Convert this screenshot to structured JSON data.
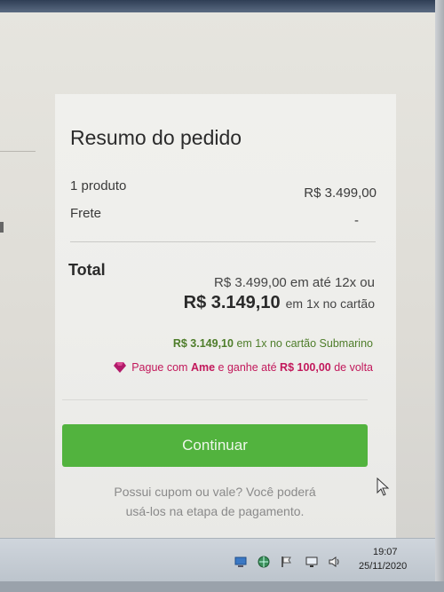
{
  "summary": {
    "title": "Resumo do pedido",
    "product_label": "1 produto",
    "product_price": "R$ 3.499,00",
    "shipping_label": "Frete",
    "shipping_value": "-",
    "total_label": "Total",
    "installments_text": "R$ 3.499,00 em até 12x ou",
    "cash_price": "R$ 3.149,10",
    "cash_text": "em 1x no cartão",
    "submarino_price": "R$ 3.149,10",
    "submarino_text": "em 1x no cartão Submarino",
    "ame_prefix": "Pague com",
    "ame_brand": "Ame",
    "ame_middle": "e ganhe até",
    "ame_cashback": "R$ 100,00",
    "ame_suffix": "de volta",
    "continue_label": "Continuar",
    "coupon_line1": "Possui cupom ou vale? Você poderá",
    "coupon_line2": "usá-los na etapa de pagamento."
  },
  "taskbar": {
    "time": "19:07",
    "date": "25/11/2020",
    "tray_icons": [
      "network-icon",
      "browser-icon",
      "flag-icon",
      "display-icon",
      "volume-icon"
    ]
  },
  "colors": {
    "button_green": "#52b33e",
    "price_green": "#4e7d2a",
    "ame_pink": "#c2185b"
  }
}
